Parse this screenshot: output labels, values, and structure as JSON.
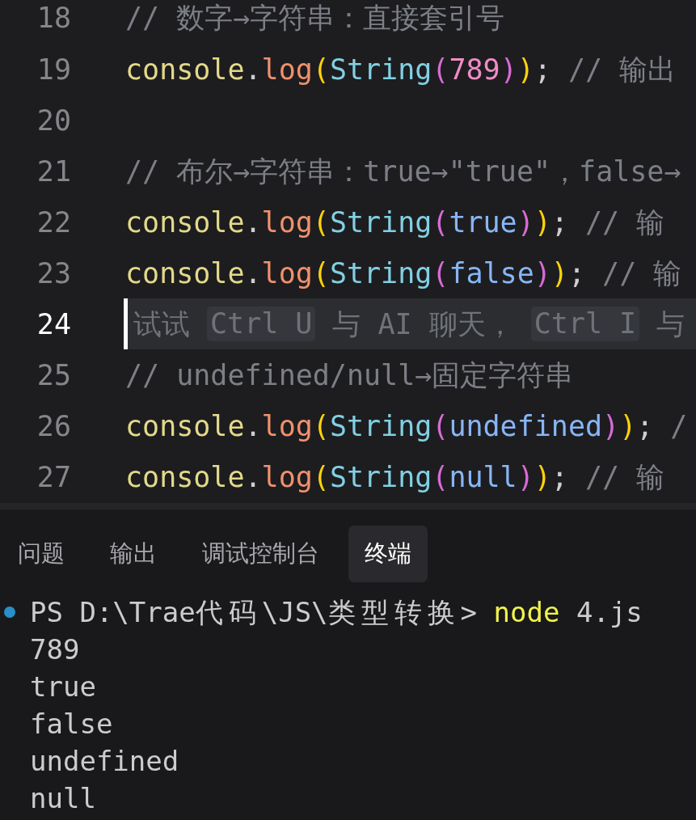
{
  "editor": {
    "lines": [
      {
        "number": "18",
        "kind": "code",
        "current": false,
        "tokens": [
          {
            "kind": "comment",
            "text": "// 数字→字符串：直接套引号"
          }
        ]
      },
      {
        "number": "19",
        "kind": "code",
        "current": false,
        "tokens": [
          {
            "kind": "object",
            "text": "console"
          },
          {
            "kind": "punct",
            "text": "."
          },
          {
            "kind": "method",
            "text": "log"
          },
          {
            "kind": "bracket1",
            "text": "("
          },
          {
            "kind": "class",
            "text": "String"
          },
          {
            "kind": "bracket2",
            "text": "("
          },
          {
            "kind": "number",
            "text": "789"
          },
          {
            "kind": "bracket2",
            "text": ")"
          },
          {
            "kind": "bracket1",
            "text": ")"
          },
          {
            "kind": "punct",
            "text": ";"
          },
          {
            "kind": "comment",
            "text": " // 输出"
          }
        ]
      },
      {
        "number": "20",
        "kind": "code",
        "current": false
      },
      {
        "number": "21",
        "kind": "code",
        "current": false,
        "tokens": [
          {
            "kind": "comment",
            "text": "// 布尔→字符串：true→\"true\"，false→"
          }
        ]
      },
      {
        "number": "22",
        "kind": "code",
        "current": false,
        "tokens": [
          {
            "kind": "object",
            "text": "console"
          },
          {
            "kind": "punct",
            "text": "."
          },
          {
            "kind": "method",
            "text": "log"
          },
          {
            "kind": "bracket1",
            "text": "("
          },
          {
            "kind": "class",
            "text": "String"
          },
          {
            "kind": "bracket2",
            "text": "("
          },
          {
            "kind": "literal",
            "text": "true"
          },
          {
            "kind": "bracket2",
            "text": ")"
          },
          {
            "kind": "bracket1",
            "text": ")"
          },
          {
            "kind": "punct",
            "text": ";"
          },
          {
            "kind": "comment",
            "text": " // 输"
          }
        ]
      },
      {
        "number": "23",
        "kind": "code",
        "current": false,
        "tokens": [
          {
            "kind": "object",
            "text": "console"
          },
          {
            "kind": "punct",
            "text": "."
          },
          {
            "kind": "method",
            "text": "log"
          },
          {
            "kind": "bracket1",
            "text": "("
          },
          {
            "kind": "class",
            "text": "String"
          },
          {
            "kind": "bracket2",
            "text": "("
          },
          {
            "kind": "literal",
            "text": "false"
          },
          {
            "kind": "bracket2",
            "text": ")"
          },
          {
            "kind": "bracket1",
            "text": ")"
          },
          {
            "kind": "punct",
            "text": ";"
          },
          {
            "kind": "comment",
            "text": " // 输"
          }
        ]
      },
      {
        "number": "24",
        "kind": "hint",
        "current": true,
        "parts": [
          {
            "kind": "text",
            "text": "试试"
          },
          {
            "kind": "key",
            "text": "Ctrl U"
          },
          {
            "kind": "text",
            "text": "与 AI 聊天，"
          },
          {
            "kind": "key",
            "text": "Ctrl I"
          },
          {
            "kind": "text",
            "text": "与"
          }
        ]
      },
      {
        "number": "25",
        "kind": "code",
        "current": false,
        "tokens": [
          {
            "kind": "comment",
            "text": "// undefined/null→固定字符串"
          }
        ]
      },
      {
        "number": "26",
        "kind": "code",
        "current": false,
        "tokens": [
          {
            "kind": "object",
            "text": "console"
          },
          {
            "kind": "punct",
            "text": "."
          },
          {
            "kind": "method",
            "text": "log"
          },
          {
            "kind": "bracket1",
            "text": "("
          },
          {
            "kind": "class",
            "text": "String"
          },
          {
            "kind": "bracket2",
            "text": "("
          },
          {
            "kind": "literal",
            "text": "undefined"
          },
          {
            "kind": "bracket2",
            "text": ")"
          },
          {
            "kind": "bracket1",
            "text": ")"
          },
          {
            "kind": "punct",
            "text": ";"
          },
          {
            "kind": "comment",
            "text": " /"
          }
        ]
      },
      {
        "number": "27",
        "kind": "code",
        "current": false,
        "tokens": [
          {
            "kind": "object",
            "text": "console"
          },
          {
            "kind": "punct",
            "text": "."
          },
          {
            "kind": "method",
            "text": "log"
          },
          {
            "kind": "bracket1",
            "text": "("
          },
          {
            "kind": "class",
            "text": "String"
          },
          {
            "kind": "bracket2",
            "text": "("
          },
          {
            "kind": "literal",
            "text": "null"
          },
          {
            "kind": "bracket2",
            "text": ")"
          },
          {
            "kind": "bracket1",
            "text": ")"
          },
          {
            "kind": "punct",
            "text": ";"
          },
          {
            "kind": "comment",
            "text": " // 输"
          }
        ]
      }
    ]
  },
  "panel": {
    "tabs": [
      {
        "label": "问题",
        "selected": false
      },
      {
        "label": "输出",
        "selected": false
      },
      {
        "label": "调试控制台",
        "selected": false
      },
      {
        "label": "终端",
        "selected": true
      }
    ]
  },
  "terminal": {
    "command": {
      "prompt": "PS D:\\Trae代码\\JS\\类型转换>",
      "program": "node",
      "args": "4.js"
    },
    "output": [
      "789",
      "true",
      "false",
      "undefined",
      "null"
    ]
  }
}
